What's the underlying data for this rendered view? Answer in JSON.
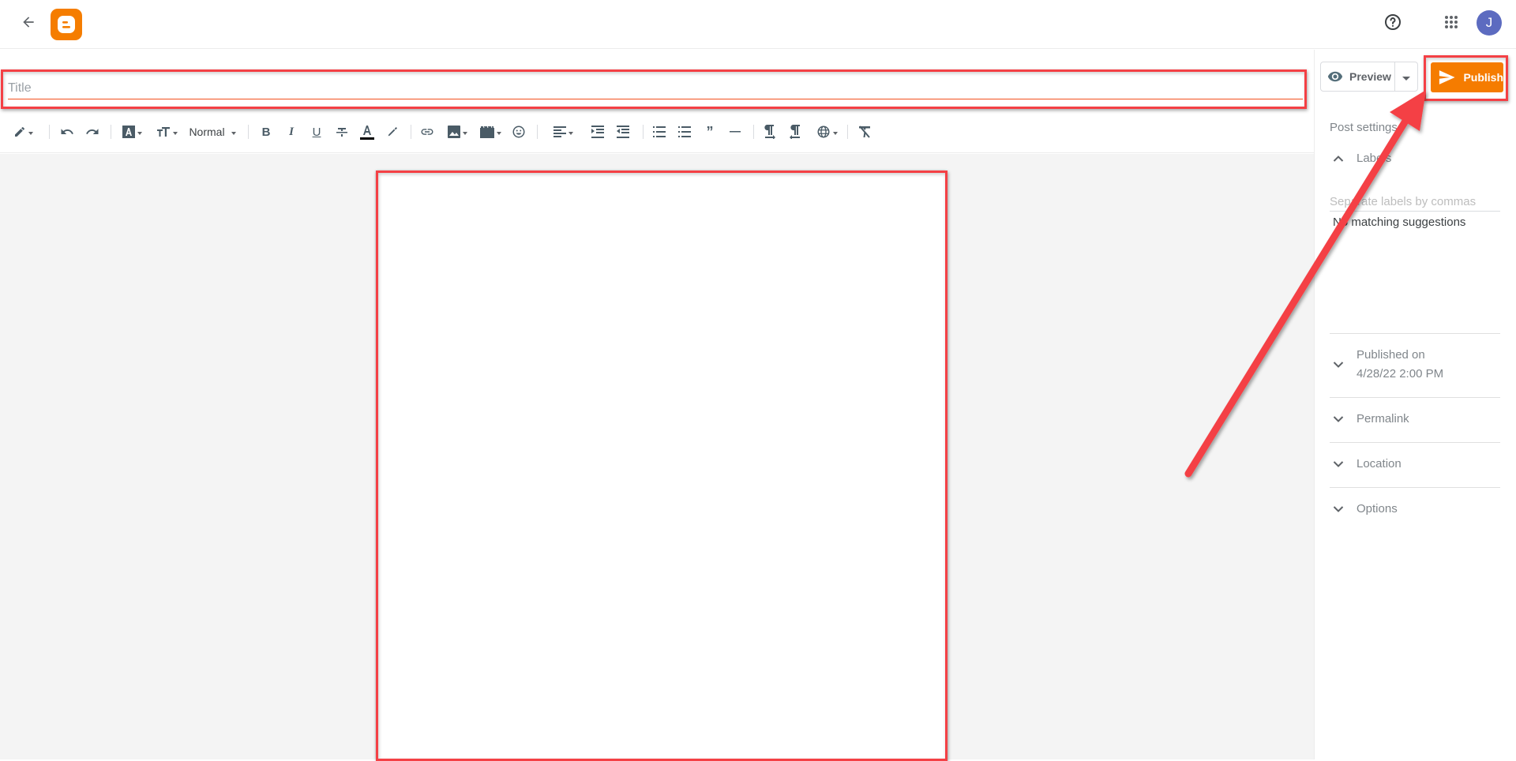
{
  "header": {
    "back_icon": "arrow-left-icon",
    "logo_icon": "blogger-logo-icon",
    "help_icon": "help-circle-icon",
    "apps_icon": "apps-grid-icon",
    "avatar_initial": "J",
    "avatar_color": "#5c6bc0"
  },
  "editor": {
    "title_placeholder": "Title",
    "title_value": "",
    "body_value": ""
  },
  "toolbar": {
    "items": [
      {
        "name": "compose-mode",
        "icon": "pencil-icon",
        "dropdown": true
      },
      {
        "name": "undo",
        "icon": "undo-icon"
      },
      {
        "name": "redo",
        "icon": "redo-icon"
      },
      {
        "name": "font",
        "icon": "font-icon",
        "dropdown": true
      },
      {
        "name": "font-size",
        "icon": "text-size-icon",
        "dropdown": true
      },
      {
        "name": "paragraph-style",
        "label": "Normal",
        "dropdown": true
      },
      {
        "name": "bold",
        "icon": "bold-icon"
      },
      {
        "name": "italic",
        "icon": "italic-icon"
      },
      {
        "name": "underline",
        "icon": "underline-icon"
      },
      {
        "name": "strikethrough",
        "icon": "strikethrough-icon"
      },
      {
        "name": "text-color",
        "icon": "text-color-icon"
      },
      {
        "name": "highlight",
        "icon": "highlighter-icon"
      },
      {
        "name": "link",
        "icon": "link-icon"
      },
      {
        "name": "image",
        "icon": "image-icon",
        "dropdown": true
      },
      {
        "name": "video",
        "icon": "video-icon",
        "dropdown": true
      },
      {
        "name": "emoji",
        "icon": "emoji-icon"
      },
      {
        "name": "align",
        "icon": "align-left-icon",
        "dropdown": true
      },
      {
        "name": "indent",
        "icon": "indent-icon"
      },
      {
        "name": "outdent",
        "icon": "outdent-icon"
      },
      {
        "name": "bulleted-list",
        "icon": "bulleted-list-icon"
      },
      {
        "name": "numbered-list",
        "icon": "numbered-list-icon"
      },
      {
        "name": "quote",
        "icon": "quote-icon"
      },
      {
        "name": "horizontal-rule",
        "icon": "horizontal-rule-icon"
      },
      {
        "name": "ltr",
        "icon": "ltr-icon"
      },
      {
        "name": "rtl",
        "icon": "rtl-icon"
      },
      {
        "name": "language",
        "icon": "globe-icon",
        "dropdown": true
      },
      {
        "name": "clear-formatting",
        "icon": "clear-format-icon"
      }
    ],
    "normal_label": "Normal"
  },
  "actions": {
    "preview_label": "Preview",
    "publish_label": "Publish",
    "publish_color": "#f57c00"
  },
  "sidebar": {
    "title": "Post settings",
    "labels": {
      "label": "Labels",
      "expanded": true,
      "placeholder": "Separate labels by commas",
      "suggestions_text": "No matching suggestions"
    },
    "published": {
      "line1": "Published on",
      "line2": "4/28/22 2:00 PM"
    },
    "permalink_label": "Permalink",
    "location_label": "Location",
    "options_label": "Options"
  },
  "annotations": {
    "highlight_color": "#f44045",
    "highlighted": [
      "title-input",
      "post-body",
      "publish-button"
    ],
    "arrow": "points to publish-button"
  }
}
